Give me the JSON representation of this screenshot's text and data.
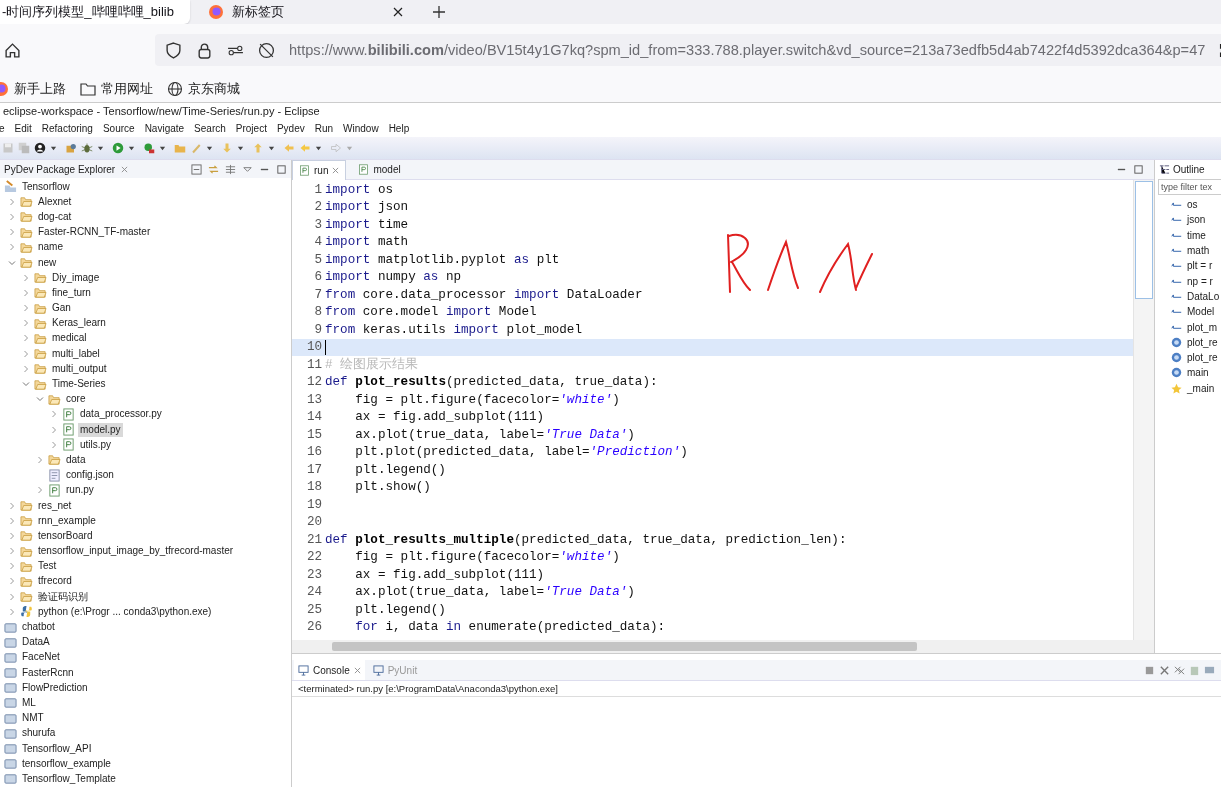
{
  "browser": {
    "tabs": [
      {
        "title": "-时间序列模型_哔哩哔哩_bilib",
        "selected": true
      },
      {
        "title": "新标签页",
        "selected": false
      }
    ],
    "url": "https://www.**bilibili.com**/video/BV15t4y1G7kq?spm_id_from=333.788.player.switch&vd_source=213a73edfb5d4ab7422f4d5392dca364&p=47",
    "bookmarks": [
      {
        "kind": "firefox",
        "label": "新手上路"
      },
      {
        "kind": "folder",
        "label": "常用网址"
      },
      {
        "kind": "globe",
        "label": "京东商城"
      }
    ]
  },
  "eclipse": {
    "title": "eclipse-workspace - Tensorflow/new/Time-Series/run.py - Eclipse",
    "menu": [
      "e",
      "Edit",
      "Refactoring",
      "Source",
      "Navigate",
      "Search",
      "Project",
      "Pydev",
      "Run",
      "Window",
      "Help"
    ],
    "explorer": {
      "title": "PyDev Package Explorer",
      "tree": [
        {
          "kind": "project",
          "label": "Tensorflow",
          "children": [
            {
              "kind": "folder",
              "label": "Alexnet",
              "expanded": false,
              "selected": false
            },
            {
              "kind": "folder",
              "label": "dog-cat",
              "expanded": false,
              "selected": false
            },
            {
              "kind": "folder",
              "label": "Faster-RCNN_TF-master",
              "expanded": false,
              "selected": false
            },
            {
              "kind": "folder",
              "label": "name",
              "expanded": false,
              "selected": false
            },
            {
              "kind": "folder",
              "label": "new",
              "expanded": true,
              "selected": false,
              "children": [
                {
                  "kind": "folder",
                  "label": "Diy_image",
                  "expanded": false,
                  "selected": false
                },
                {
                  "kind": "folder",
                  "label": "fine_turn",
                  "expanded": false,
                  "selected": false
                },
                {
                  "kind": "folder",
                  "label": "Gan",
                  "expanded": false,
                  "selected": false
                },
                {
                  "kind": "folder",
                  "label": "Keras_learn",
                  "expanded": false,
                  "selected": false
                },
                {
                  "kind": "folder",
                  "label": "medical",
                  "expanded": false,
                  "selected": false
                },
                {
                  "kind": "folder",
                  "label": "multi_label",
                  "expanded": false,
                  "selected": false
                },
                {
                  "kind": "folder",
                  "label": "multi_output",
                  "expanded": false,
                  "selected": false
                },
                {
                  "kind": "folder",
                  "label": "Time-Series",
                  "expanded": true,
                  "selected": false,
                  "children": [
                    {
                      "kind": "folder",
                      "label": "core",
                      "expanded": true,
                      "selected": false,
                      "children": [
                        {
                          "kind": "pyfile",
                          "label": "data_processor.py",
                          "expanded": false,
                          "selected": false
                        },
                        {
                          "kind": "pyfile",
                          "label": "model.py",
                          "expanded": false,
                          "selected": true
                        },
                        {
                          "kind": "pyfile",
                          "label": "utils.py",
                          "expanded": false,
                          "selected": false
                        }
                      ]
                    },
                    {
                      "kind": "folder",
                      "label": "data",
                      "expanded": false,
                      "selected": false
                    },
                    {
                      "kind": "file",
                      "label": "config.json",
                      "selected": false
                    },
                    {
                      "kind": "pyfile",
                      "label": "run.py",
                      "expanded": false,
                      "selected": false
                    }
                  ]
                }
              ]
            },
            {
              "kind": "folder",
              "label": "res_net",
              "expanded": false,
              "selected": false
            },
            {
              "kind": "folder",
              "label": "rnn_example",
              "expanded": false,
              "selected": false
            },
            {
              "kind": "folder",
              "label": "tensorBoard",
              "expanded": false,
              "selected": false
            },
            {
              "kind": "folder",
              "label": "tensorflow_input_image_by_tfrecord-master",
              "expanded": false,
              "selected": false
            },
            {
              "kind": "folder",
              "label": "Test",
              "expanded": false,
              "selected": false
            },
            {
              "kind": "folder",
              "label": "tfrecord",
              "expanded": false,
              "selected": false
            },
            {
              "kind": "folder",
              "label": "验证码识别",
              "expanded": false,
              "selected": false
            },
            {
              "kind": "interpreter",
              "label": "python  (e:\\Progr ... conda3\\python.exe)",
              "expanded": false,
              "selected": false
            }
          ]
        },
        {
          "kind": "closed",
          "label": "chatbot",
          "selected": false
        },
        {
          "kind": "closed",
          "label": "DataA",
          "selected": false
        },
        {
          "kind": "closed",
          "label": "FaceNet",
          "selected": false
        },
        {
          "kind": "closed",
          "label": "FasterRcnn",
          "selected": false
        },
        {
          "kind": "closed",
          "label": "FlowPrediction",
          "selected": false
        },
        {
          "kind": "closed",
          "label": "ML",
          "selected": false
        },
        {
          "kind": "closed",
          "label": "NMT",
          "selected": false
        },
        {
          "kind": "closed",
          "label": "shurufa",
          "selected": false
        },
        {
          "kind": "closed",
          "label": "Tensorflow_API",
          "selected": false
        },
        {
          "kind": "closed",
          "label": "tensorflow_example",
          "selected": false
        },
        {
          "kind": "closed",
          "label": "Tensorflow_Template",
          "selected": false
        }
      ]
    },
    "editor": {
      "tabs": [
        {
          "label": "run",
          "selected": true
        },
        {
          "label": "model",
          "selected": false
        }
      ],
      "lines": [
        {
          "no": "1",
          "current": false,
          "tokens": [
            {
              "kind": "keyword",
              "text": "import"
            },
            {
              "kind": "plain",
              "text": " os"
            }
          ]
        },
        {
          "no": "2",
          "current": false,
          "tokens": [
            {
              "kind": "keyword",
              "text": "import"
            },
            {
              "kind": "plain",
              "text": " json"
            }
          ]
        },
        {
          "no": "3",
          "current": false,
          "tokens": [
            {
              "kind": "keyword",
              "text": "import"
            },
            {
              "kind": "plain",
              "text": " time"
            }
          ]
        },
        {
          "no": "4",
          "current": false,
          "tokens": [
            {
              "kind": "keyword",
              "text": "import"
            },
            {
              "kind": "plain",
              "text": " math"
            }
          ]
        },
        {
          "no": "5",
          "current": false,
          "tokens": [
            {
              "kind": "keyword",
              "text": "import"
            },
            {
              "kind": "plain",
              "text": " matplotlib.pyplot "
            },
            {
              "kind": "keyword",
              "text": "as"
            },
            {
              "kind": "plain",
              "text": " plt"
            }
          ]
        },
        {
          "no": "6",
          "current": false,
          "tokens": [
            {
              "kind": "keyword",
              "text": "import"
            },
            {
              "kind": "plain",
              "text": " numpy "
            },
            {
              "kind": "keyword",
              "text": "as"
            },
            {
              "kind": "plain",
              "text": " np"
            }
          ]
        },
        {
          "no": "7",
          "current": false,
          "tokens": [
            {
              "kind": "keyword",
              "text": "from"
            },
            {
              "kind": "plain",
              "text": " core.data_processor "
            },
            {
              "kind": "keyword",
              "text": "import"
            },
            {
              "kind": "plain",
              "text": " DataLoader"
            }
          ]
        },
        {
          "no": "8",
          "current": false,
          "tokens": [
            {
              "kind": "keyword",
              "text": "from"
            },
            {
              "kind": "plain",
              "text": " core.model "
            },
            {
              "kind": "keyword",
              "text": "import"
            },
            {
              "kind": "plain",
              "text": " Model"
            }
          ]
        },
        {
          "no": "9",
          "current": false,
          "tokens": [
            {
              "kind": "keyword",
              "text": "from"
            },
            {
              "kind": "plain",
              "text": " keras.utils "
            },
            {
              "kind": "keyword",
              "text": "import"
            },
            {
              "kind": "plain",
              "text": " plot_model"
            }
          ]
        },
        {
          "no": "10",
          "current": true
        },
        {
          "no": "11",
          "current": false,
          "tokens": [
            {
              "kind": "comment",
              "text": "# 绘图展示结果"
            }
          ]
        },
        {
          "no": "12",
          "current": false,
          "tokens": [
            {
              "kind": "keyword",
              "text": "def"
            },
            {
              "kind": "name",
              "text": " plot_results"
            },
            {
              "kind": "plain",
              "text": "(predicted_data, true_data):"
            }
          ]
        },
        {
          "no": "13",
          "current": false,
          "tokens": [
            {
              "kind": "plain",
              "text": "    fig = plt.figure(facecolor="
            },
            {
              "kind": "string",
              "text": "'white'"
            },
            {
              "kind": "plain",
              "text": ")"
            }
          ]
        },
        {
          "no": "14",
          "current": false,
          "tokens": [
            {
              "kind": "plain",
              "text": "    ax = fig.add_subplot(111)"
            }
          ]
        },
        {
          "no": "15",
          "current": false,
          "tokens": [
            {
              "kind": "plain",
              "text": "    ax.plot(true_data, label="
            },
            {
              "kind": "string",
              "text": "'True Data'"
            },
            {
              "kind": "plain",
              "text": ")"
            }
          ]
        },
        {
          "no": "16",
          "current": false,
          "tokens": [
            {
              "kind": "plain",
              "text": "    plt.plot(predicted_data, label="
            },
            {
              "kind": "string",
              "text": "'Prediction'"
            },
            {
              "kind": "plain",
              "text": ")"
            }
          ]
        },
        {
          "no": "17",
          "current": false,
          "tokens": [
            {
              "kind": "plain",
              "text": "    plt.legend()"
            }
          ]
        },
        {
          "no": "18",
          "current": false,
          "tokens": [
            {
              "kind": "plain",
              "text": "    plt.show()"
            }
          ]
        },
        {
          "no": "19",
          "current": false
        },
        {
          "no": "20",
          "current": false
        },
        {
          "no": "21",
          "current": false,
          "tokens": [
            {
              "kind": "keyword",
              "text": "def"
            },
            {
              "kind": "name",
              "text": " plot_results_multiple"
            },
            {
              "kind": "plain",
              "text": "(predicted_data, true_data, prediction_len):"
            }
          ]
        },
        {
          "no": "22",
          "current": false,
          "tokens": [
            {
              "kind": "plain",
              "text": "    fig = plt.figure(facecolor="
            },
            {
              "kind": "string",
              "text": "'white'"
            },
            {
              "kind": "plain",
              "text": ")"
            }
          ]
        },
        {
          "no": "23",
          "current": false,
          "tokens": [
            {
              "kind": "plain",
              "text": "    ax = fig.add_subplot(111)"
            }
          ]
        },
        {
          "no": "24",
          "current": false,
          "tokens": [
            {
              "kind": "plain",
              "text": "    ax.plot(true_data, label="
            },
            {
              "kind": "string",
              "text": "'True Data'"
            },
            {
              "kind": "plain",
              "text": ")"
            }
          ]
        },
        {
          "no": "25",
          "current": false,
          "tokens": [
            {
              "kind": "plain",
              "text": "    plt.legend()"
            }
          ]
        },
        {
          "no": "26",
          "current": false,
          "tokens": [
            {
              "kind": "keyword",
              "text": "    for"
            },
            {
              "kind": "plain",
              "text": " i, data "
            },
            {
              "kind": "keyword",
              "text": "in"
            },
            {
              "kind": "plain",
              "text": " enumerate(predicted_data):"
            }
          ]
        }
      ]
    },
    "outline": {
      "title": "Outline",
      "filter_placeholder": "type filter tex",
      "items": [
        {
          "kind": "import",
          "label": "os"
        },
        {
          "kind": "import",
          "label": "json"
        },
        {
          "kind": "import",
          "label": "time"
        },
        {
          "kind": "import",
          "label": "math"
        },
        {
          "kind": "import",
          "label": "plt = r"
        },
        {
          "kind": "import",
          "label": "np = r"
        },
        {
          "kind": "import",
          "label": "DataLo"
        },
        {
          "kind": "import",
          "label": "Model"
        },
        {
          "kind": "import",
          "label": "plot_m"
        },
        {
          "kind": "function",
          "label": "plot_re"
        },
        {
          "kind": "function",
          "label": "plot_re"
        },
        {
          "kind": "function",
          "label": "main"
        },
        {
          "kind": "main",
          "label": "_main"
        }
      ]
    },
    "console": {
      "tabs": [
        {
          "label": "Console",
          "selected": true
        },
        {
          "label": "PyUnit",
          "selected": false
        }
      ],
      "status": "<terminated> run.py [e:\\ProgramData\\Anaconda3\\python.exe]"
    }
  }
}
